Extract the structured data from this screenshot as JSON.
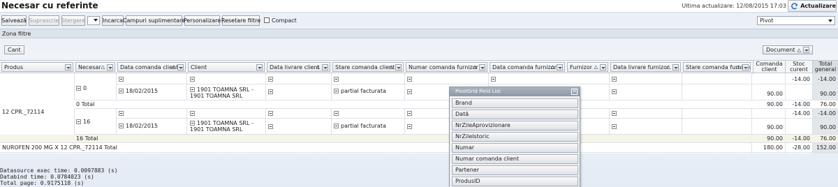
{
  "header": {
    "title": "Necesar cu referinte",
    "last_update": "Ultima actualizare: 12/08/2015 17:03",
    "refresh_label": "Actualizare"
  },
  "toolbar": {
    "save": "Salvează",
    "overwrite": "Suprascrie",
    "delete": "Stergere",
    "load": "Incarca",
    "extra_fields": "Campuri suplimentare",
    "customize": "Personalizare",
    "reset_filters": "Resetare filtre",
    "compact": "Compact",
    "view_select": "Pivot"
  },
  "zone": {
    "label": "Zona filtre",
    "data_field": "Cant",
    "column_field": "Document"
  },
  "columns": {
    "row_fields": [
      "Produs",
      "Necesar",
      "Data comanda client",
      "Client",
      "Data livrare client",
      "Stare comanda client",
      "Numar comanda furnizor",
      "Data comanda furnizor",
      "Furnizor",
      "Data livrare furnizor",
      "Stare comanda furnizor"
    ],
    "values": [
      "Comanda client",
      "Stoc curent",
      "Total general"
    ]
  },
  "rows": {
    "product": "NUROFEN 200 MG X 12 CPR._72114",
    "necesar_0": "0",
    "necesar_16": "16",
    "date": "18/02/2015",
    "client": "1901 TOAMNA SRL - 1901 TOAMNA SRL",
    "status": "partial facturata",
    "r1": {
      "cc": "",
      "sc": "-14.00",
      "tg": "-14.00"
    },
    "r2": {
      "cc": "90.00",
      "sc": "",
      "tg": "90.00"
    },
    "total_0_label": "0 Total",
    "total_0": {
      "cc": "90.00",
      "sc": "-14.00",
      "tg": "76.00"
    },
    "r3": {
      "cc": "",
      "sc": "-14.00",
      "tg": "-14.00"
    },
    "r4": {
      "cc": "90.00",
      "sc": "",
      "tg": "90.00"
    },
    "total_16_label": "16 Total",
    "total_16": {
      "cc": "90.00",
      "sc": "-14.00",
      "tg": "76.00"
    },
    "grand_label": "NUROFEN 200 MG X 12 CPR._72114 Total",
    "grand": {
      "cc": "180.00",
      "sc": "-28.00",
      "tg": "152.00"
    }
  },
  "field_list": {
    "title": "PivotGrid Field List",
    "items": [
      "Brand",
      "Dată",
      "NrZileAprovizionare",
      "NrZileIstoric",
      "Numar",
      "Numar comanda client",
      "Partener",
      "ProdusID"
    ]
  },
  "footer": {
    "line1": "Datasource exec time: 0.0097883 (s)",
    "line2": "Databind time: 0.0784023 (s)",
    "line3": "Total page: 0.9175118 (s)"
  }
}
